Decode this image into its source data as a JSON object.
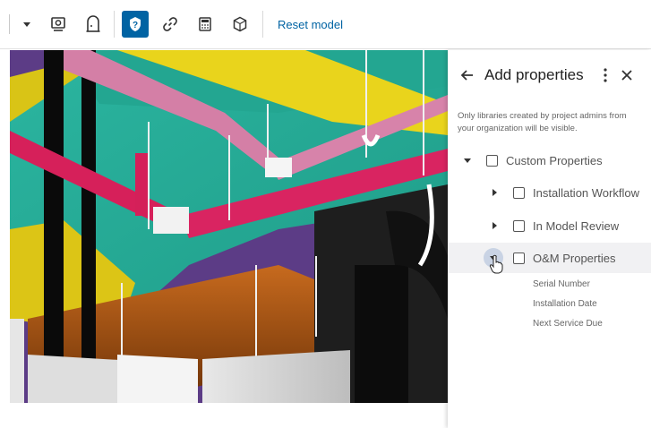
{
  "toolbar": {
    "reset_model_label": "Reset model",
    "active_color": "#0063a3",
    "icons": [
      "dropdown-caret",
      "screen-view-icon",
      "door-icon",
      "help-icon",
      "link-icon",
      "calculator-icon",
      "cube-icon"
    ]
  },
  "panel": {
    "title": "Add properties",
    "note": "Only libraries created by project admins from your organization will be visible.",
    "tree": {
      "root": {
        "label": "Custom Properties",
        "expanded": true,
        "checked": false
      },
      "children": [
        {
          "label": "Installation Workflow",
          "expanded": false,
          "checked": false
        },
        {
          "label": "In Model Review",
          "expanded": false,
          "checked": false
        },
        {
          "label": "O&M Properties",
          "expanded": true,
          "checked": false,
          "properties": [
            "Serial Number",
            "Installation Date",
            "Next Service Due"
          ]
        }
      ]
    }
  }
}
